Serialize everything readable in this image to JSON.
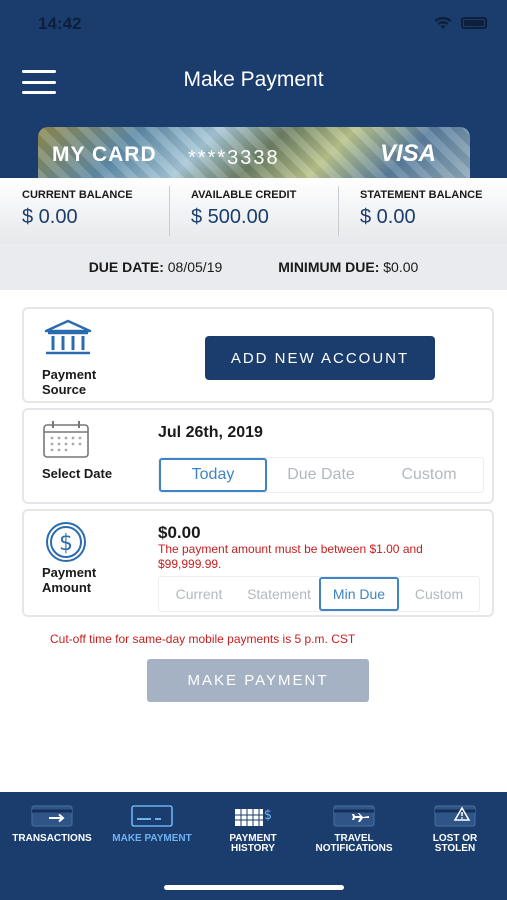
{
  "status": {
    "time": "14:42"
  },
  "header": {
    "title": "Make Payment"
  },
  "card": {
    "name": "MY CARD",
    "number": "****3338",
    "brand": "VISA"
  },
  "balances": [
    {
      "label": "CURRENT BALANCE",
      "value": "$ 0.00"
    },
    {
      "label": "AVAILABLE CREDIT",
      "value": "$ 500.00"
    },
    {
      "label": "STATEMENT BALANCE",
      "value": "$ 0.00"
    }
  ],
  "due": {
    "date_label": "DUE DATE:",
    "date_value": "08/05/19",
    "min_label": "MINIMUM DUE:",
    "min_value": "$0.00"
  },
  "payment_source": {
    "label_line1": "Payment",
    "label_line2": "Source",
    "button": "ADD NEW ACCOUNT"
  },
  "select_date": {
    "label": "Select Date",
    "value": "Jul 26th, 2019",
    "options": [
      "Today",
      "Due Date",
      "Custom"
    ],
    "selected": "Today"
  },
  "payment_amount": {
    "label_line1": "Payment",
    "label_line2": "Amount",
    "value": "$0.00",
    "error": "The payment amount must be between $1.00 and $99,999.99.",
    "options": [
      "Current",
      "Statement",
      "Min Due",
      "Custom"
    ],
    "selected": "Min Due"
  },
  "cutoff_text": "Cut-off time for same-day mobile payments is 5 p.m. CST",
  "make_payment_button": "MAKE PAYMENT",
  "tabs": [
    {
      "line1": "TRANSACTIONS",
      "line2": "",
      "icon": "card-arrow-icon"
    },
    {
      "line1": "MAKE PAYMENT",
      "line2": "",
      "icon": "card-payment-icon",
      "active": true
    },
    {
      "line1": "PAYMENT",
      "line2": "HISTORY",
      "icon": "calendar-dollar-icon"
    },
    {
      "line1": "TRAVEL",
      "line2": "NOTIFICATIONS",
      "icon": "card-plane-icon"
    },
    {
      "line1": "LOST OR",
      "line2": "STOLEN",
      "icon": "card-alert-icon"
    }
  ],
  "colors": {
    "navy": "#1a3d6e",
    "accent": "#3f84c4",
    "error": "#c81e1e",
    "disabled": "#a5b2c4",
    "active_tab": "#6fb2f0"
  }
}
